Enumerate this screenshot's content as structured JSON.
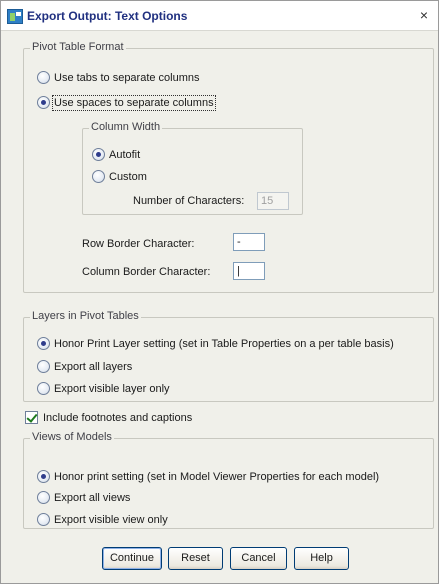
{
  "window": {
    "title": "Export Output: Text Options",
    "close_symbol": "×",
    "app_icon": "spss-app-icon"
  },
  "pivot_table_format": {
    "legend": "Pivot Table Format",
    "options": [
      {
        "label": "Use tabs to separate columns",
        "checked": false
      },
      {
        "label": "Use spaces to separate columns",
        "checked": true
      }
    ],
    "column_width": {
      "legend": "Column Width",
      "options": [
        {
          "label": "Autofit",
          "checked": true
        },
        {
          "label": "Custom",
          "checked": false
        }
      ],
      "num_chars_label": "Number of Characters:",
      "num_chars_value": "15"
    },
    "row_border_label": "Row Border Character:",
    "row_border_value": "-",
    "column_border_label": "Column Border Character:",
    "column_border_value": "|"
  },
  "layers": {
    "legend": "Layers in Pivot Tables",
    "options": [
      {
        "label": "Honor Print Layer setting (set in Table Properties on a per table basis)",
        "checked": true
      },
      {
        "label": "Export all layers",
        "checked": false
      },
      {
        "label": "Export visible layer only",
        "checked": false
      }
    ]
  },
  "footnotes": {
    "label": "Include footnotes and captions",
    "checked": true
  },
  "views": {
    "legend": "Views of Models",
    "options": [
      {
        "label": "Honor print setting (set in Model Viewer Properties for each model)",
        "checked": true
      },
      {
        "label": "Export all views",
        "checked": false
      },
      {
        "label": "Export visible view only",
        "checked": false
      }
    ]
  },
  "buttons": {
    "continue": "Continue",
    "reset": "Reset",
    "cancel": "Cancel",
    "help": "Help"
  }
}
